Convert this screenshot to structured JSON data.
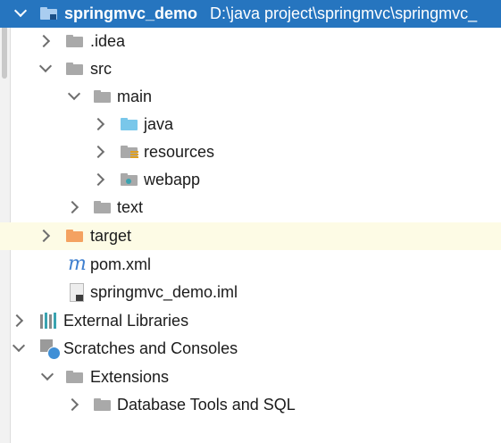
{
  "project_tree": {
    "root": {
      "name": "springmvc_demo",
      "path": "D:\\java project\\springmvc\\springmvc_"
    },
    "items": [
      {
        "label": ".idea"
      },
      {
        "label": "src"
      },
      {
        "label": "main"
      },
      {
        "label": "java"
      },
      {
        "label": "resources"
      },
      {
        "label": "webapp"
      },
      {
        "label": "text"
      },
      {
        "label": "target"
      },
      {
        "label": "pom.xml",
        "icon_glyph": "m"
      },
      {
        "label": "springmvc_demo.iml"
      },
      {
        "label": "External Libraries"
      },
      {
        "label": "Scratches and Consoles"
      },
      {
        "label": "Extensions"
      },
      {
        "label": "Database Tools and SQL"
      }
    ]
  },
  "colors": {
    "selection": "#2675bf",
    "hover_row": "#fdfbe5",
    "folder_grey": "#a9a9a9",
    "source_folder_blue": "#79c7ea",
    "excluded_folder_orange": "#f4a261",
    "maven_m": "#3f7fcf",
    "libraries_teal": "#3aa3b0"
  },
  "icons": [
    "module-folder-icon",
    "folder-icon",
    "source-root-folder-icon",
    "resources-root-folder-icon",
    "web-folder-icon",
    "excluded-folder-icon",
    "maven-pom-icon",
    "iml-file-icon",
    "external-libraries-icon",
    "scratches-console-icon",
    "chevron-right-icon",
    "chevron-down-icon"
  ]
}
